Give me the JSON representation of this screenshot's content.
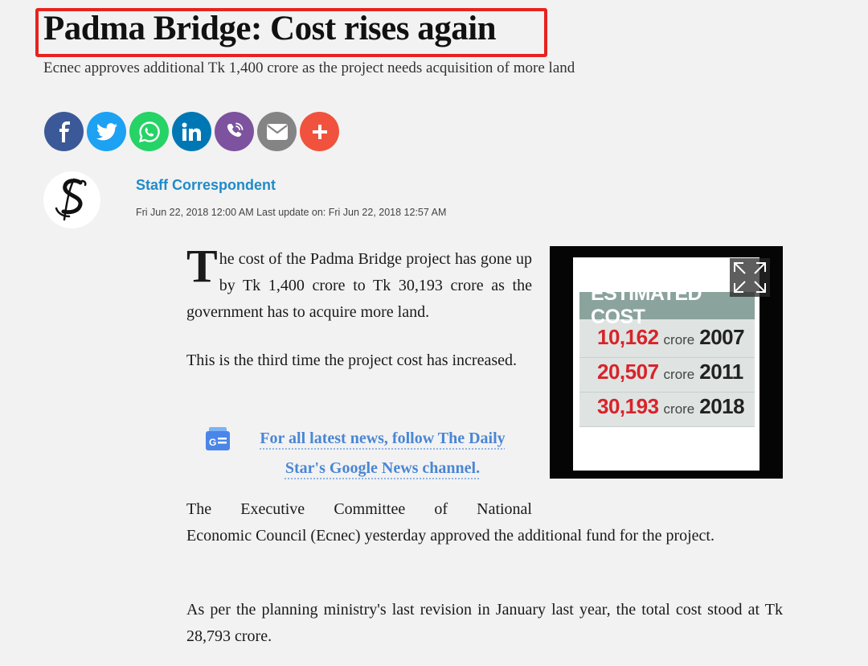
{
  "article": {
    "headline": "Padma Bridge: Cost rises again",
    "subheadline": "Ecnec approves additional Tk 1,400 crore as the project needs acquisition of more land",
    "author": "Staff Correspondent",
    "timestamp": "Fri Jun 22, 2018 12:00 AM Last update on: Fri Jun 22, 2018 12:57 AM",
    "dropcap": "T",
    "para1_rest": "he cost of the Padma Bridge project has gone up by Tk 1,400 crore to Tk 30,193 crore as the government has to acquire more land.",
    "para2": "This is the third time the project cost has increased.",
    "gnews_link": "For all latest news, follow The Daily Star's Google News channel.",
    "para3_line1": "The Executive Committee of National",
    "para3_rest": "Economic Council (Ecnec) yesterday approved the additional fund for the project.",
    "para4": "As per the planning ministry's last revision in January last year, the total cost stood at Tk 28,793 crore."
  },
  "share": [
    {
      "name": "facebook",
      "icon": "facebook-icon",
      "color": "#3b5998"
    },
    {
      "name": "twitter",
      "icon": "twitter-icon",
      "color": "#1da1f2"
    },
    {
      "name": "whatsapp",
      "icon": "whatsapp-icon",
      "color": "#25d366"
    },
    {
      "name": "linkedin",
      "icon": "linkedin-icon",
      "color": "#0077b5"
    },
    {
      "name": "viber",
      "icon": "viber-icon",
      "color": "#7d529e"
    },
    {
      "name": "email",
      "icon": "email-icon",
      "color": "#848484"
    },
    {
      "name": "more",
      "icon": "plus-icon",
      "color": "#f0523d"
    }
  ],
  "infographic": {
    "header": "ESTIMATED COST",
    "rows": [
      {
        "amount": "10,162",
        "unit": "crore",
        "year": "2007"
      },
      {
        "amount": "20,507",
        "unit": "crore",
        "year": "2011"
      },
      {
        "amount": "30,193",
        "unit": "crore",
        "year": "2018"
      }
    ]
  },
  "colors": {
    "highlight_border": "#e8231f",
    "author_link": "#1f8bc9",
    "gnews_link": "#4a86d4",
    "cost_red": "#d8232a"
  }
}
